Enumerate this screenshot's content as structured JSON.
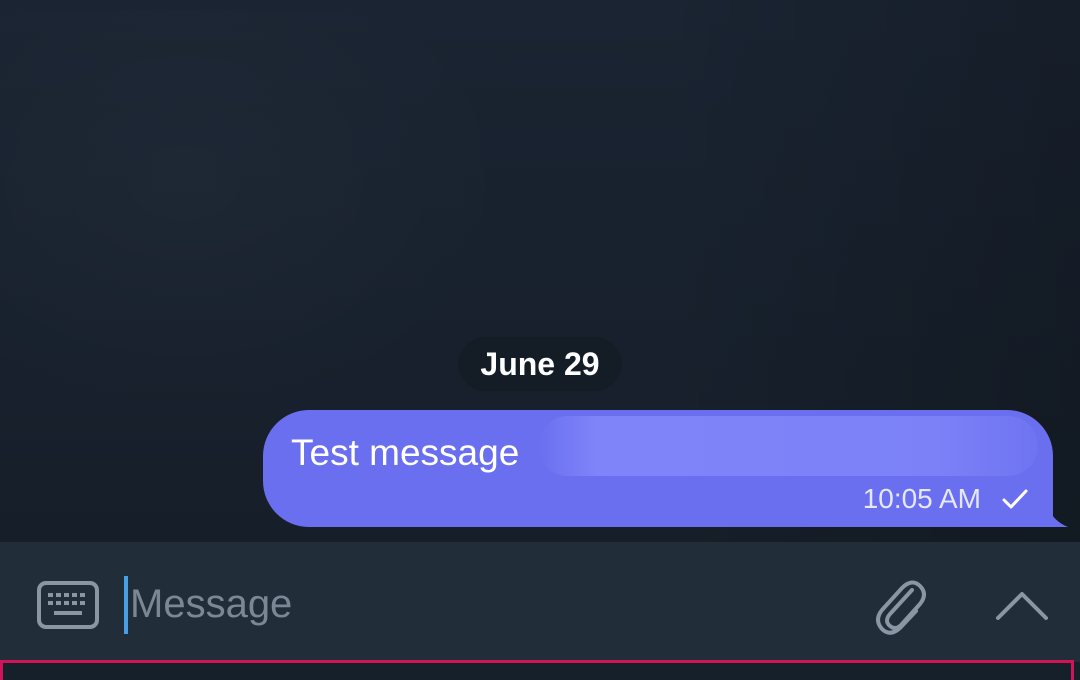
{
  "chat": {
    "date_label": "June 29",
    "message": {
      "text": "Test message",
      "time": "10:05 AM",
      "status_icon": "check-icon",
      "bubble_color": "#6a6ff0"
    }
  },
  "composer": {
    "placeholder": "Message",
    "value": "",
    "left_icon": "keyboard-icon",
    "attach_icon": "paperclip-icon",
    "expand_icon": "chevron-up-icon",
    "cursor_color": "#4a9fe3"
  },
  "colors": {
    "background": "#17212b",
    "composer_bar": "#222d3a",
    "highlight": "#d0145a"
  }
}
